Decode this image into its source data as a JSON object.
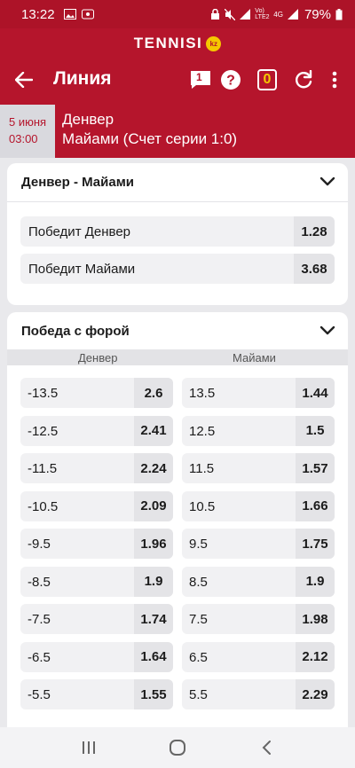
{
  "status_bar": {
    "time": "13:22",
    "network": "4G",
    "volte": "Vo) LTE2",
    "battery": "79%"
  },
  "brand": {
    "name": "TENNISI",
    "badge": "kz"
  },
  "header": {
    "title": "Линия",
    "chat_badge": "1",
    "bet_count": "0"
  },
  "event": {
    "date": "5 июня",
    "time": "03:00",
    "team1": "Денвер",
    "team2": "Майами (Счет серии 1:0)"
  },
  "winner_market": {
    "title": "Денвер - Майами",
    "outcomes": [
      {
        "label": "Победит Денвер",
        "odds": "1.28"
      },
      {
        "label": "Победит Майами",
        "odds": "3.68"
      }
    ]
  },
  "handicap_market": {
    "title": "Победа с форой",
    "col_left": "Денвер",
    "col_right": "Майами",
    "rows": [
      {
        "l_line": "-13.5",
        "l_odd": "2.6",
        "r_line": "13.5",
        "r_odd": "1.44"
      },
      {
        "l_line": "-12.5",
        "l_odd": "2.41",
        "r_line": "12.5",
        "r_odd": "1.5"
      },
      {
        "l_line": "-11.5",
        "l_odd": "2.24",
        "r_line": "11.5",
        "r_odd": "1.57"
      },
      {
        "l_line": "-10.5",
        "l_odd": "2.09",
        "r_line": "10.5",
        "r_odd": "1.66"
      },
      {
        "l_line": "-9.5",
        "l_odd": "1.96",
        "r_line": "9.5",
        "r_odd": "1.75"
      },
      {
        "l_line": "-8.5",
        "l_odd": "1.9",
        "r_line": "8.5",
        "r_odd": "1.9"
      },
      {
        "l_line": "-7.5",
        "l_odd": "1.74",
        "r_line": "7.5",
        "r_odd": "1.98"
      },
      {
        "l_line": "-6.5",
        "l_odd": "1.64",
        "r_line": "6.5",
        "r_odd": "2.12"
      },
      {
        "l_line": "-5.5",
        "l_odd": "1.55",
        "r_line": "5.5",
        "r_odd": "2.29"
      }
    ]
  },
  "colors": {
    "brand_red": "#b5152c",
    "accent_yellow": "#f5c800",
    "background": "#e9e9ec"
  }
}
